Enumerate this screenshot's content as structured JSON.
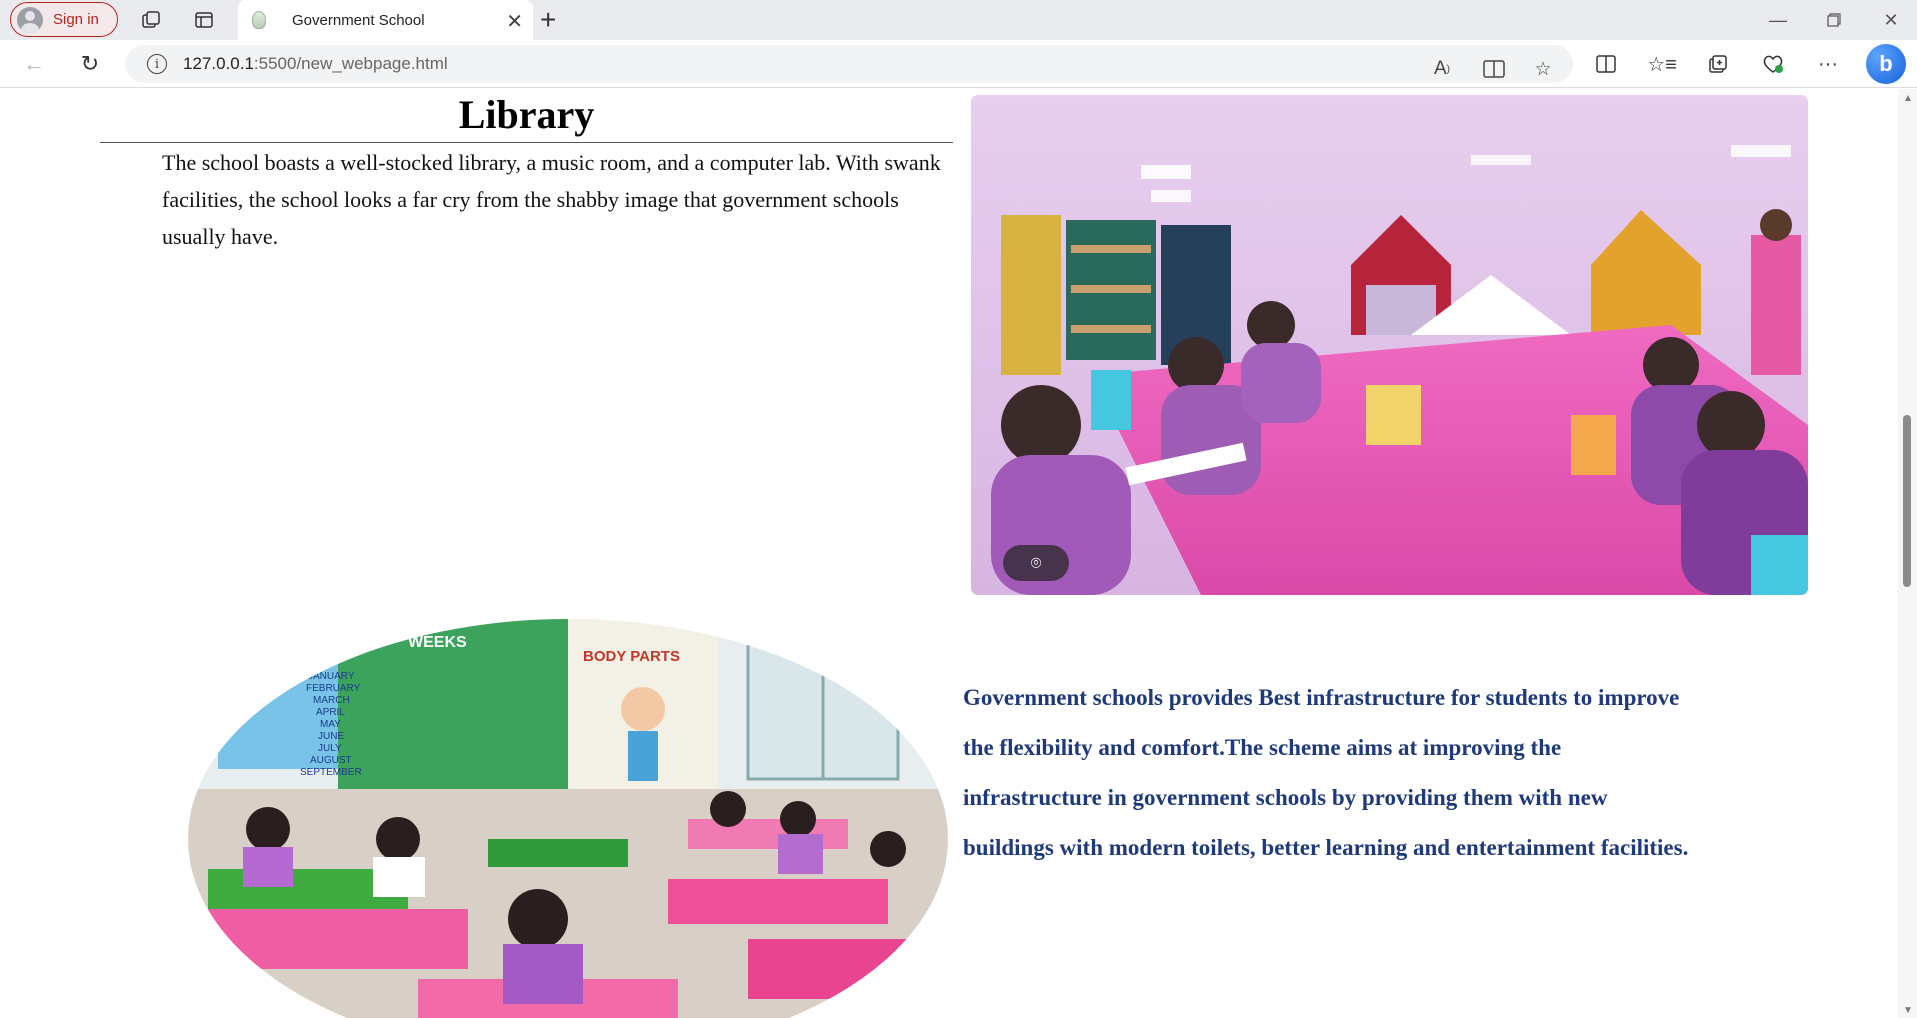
{
  "browser": {
    "sign_in_label": "Sign in",
    "tab_title": "Government School",
    "url_host": "127.0.0.1",
    "url_path": ":5500/new_webpage.html"
  },
  "page": {
    "library_heading": "Library",
    "library_text": "The school boasts a well-stocked library, a music room, and a computer lab. With swank facilities, the school looks a far cry from the shabby image that government schools usually have.",
    "infrastructure_text": "Government schools provides Best infrastructure for students to improve the flexibility and comfort.The scheme aims at improving the infrastructure in government schools by providing them with new buildings with modern toilets, better learning and entertainment facilities.",
    "classroom_chart_text": {
      "weeks": "WEEKS",
      "body_parts": "BODY PARTS",
      "months": [
        "JANUARY",
        "FEBRUARY",
        "MARCH",
        "APRIL",
        "MAY",
        "JUNE",
        "JULY",
        "AUGUST",
        "SEPTEMBER"
      ]
    }
  },
  "colors": {
    "infra_text": "#1f3a7a",
    "signin_accent": "#b3261e"
  },
  "icons": {
    "workspaces": "workspaces-icon",
    "tab_actions": "tab-actions-icon",
    "info": "info-icon",
    "read_aloud": "read-aloud-icon",
    "immersive_reader": "immersive-reader-icon",
    "favorite": "star-icon",
    "split_screen": "split-screen-icon",
    "favorites": "favorites-icon",
    "collections": "collections-icon",
    "browser_essentials": "browser-essentials-icon",
    "more": "more-icon",
    "copilot": "copilot-icon",
    "visual_search": "visual-search-icon"
  }
}
